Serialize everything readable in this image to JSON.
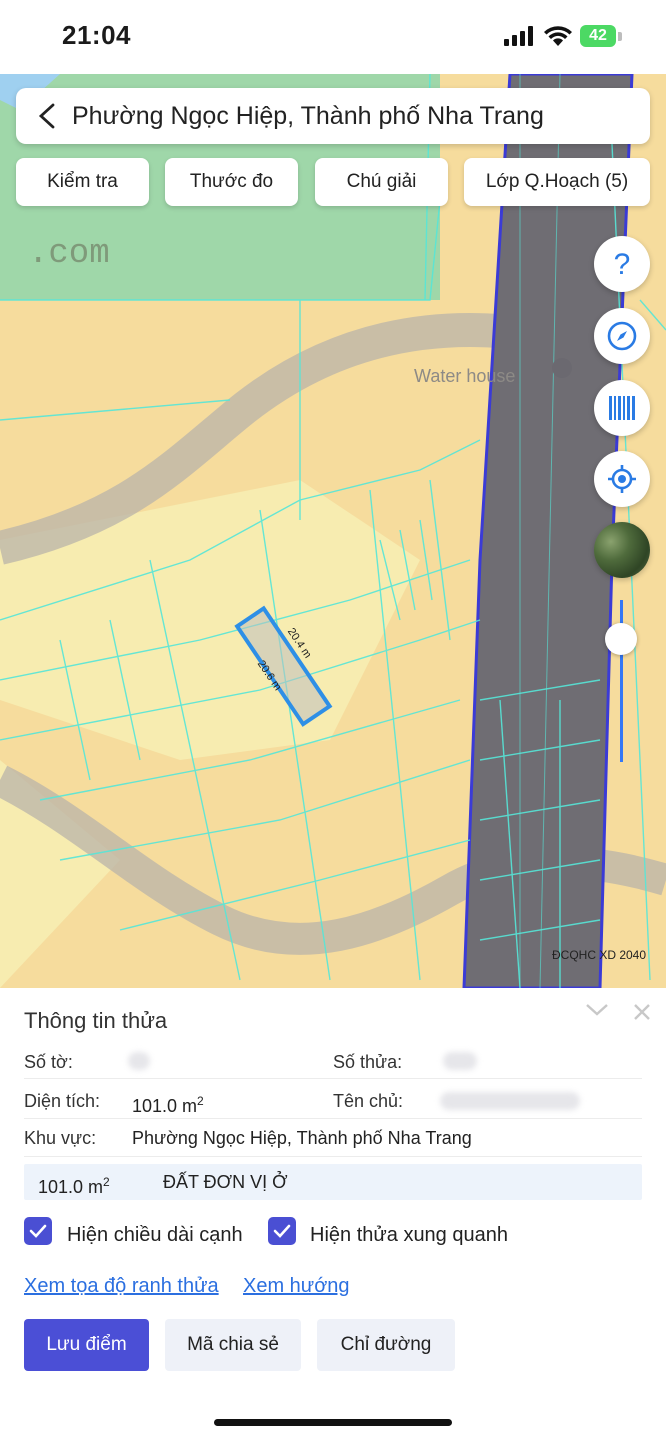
{
  "status": {
    "time": "21:04",
    "battery": "42"
  },
  "header": {
    "title": "Phường Ngọc Hiệp, Thành phố Nha Trang"
  },
  "toolbar": {
    "check": "Kiểm tra",
    "measure": "Thước đo",
    "legend": "Chú giải",
    "planning_layers": "Lớp Q.Hoạch (5)"
  },
  "map": {
    "watermark": ".com",
    "poi": "Water house",
    "edge_a": "20.4 m",
    "edge_b": "20.6 m",
    "source": "ĐCQHC XD 2040",
    "colors": {
      "residential": "#f6dc9d",
      "road": "#6f6d73",
      "parcel_lines": "#56e6d8",
      "boundary": "#3b3bd6",
      "selected": "#2e8fe6"
    }
  },
  "sheet": {
    "title": "Thông tin thửa",
    "sheet_no_label": "Số tờ:",
    "parcel_no_label": "Số thửa:",
    "area_label": "Diện tích:",
    "area_value": "101.0 m",
    "area_unit_sup": "2",
    "owner_label": "Tên chủ:",
    "region_label": "Khu vực:",
    "region_value": "Phường Ngọc Hiệp, Thành phố Nha Trang",
    "land_area": "101.0 m",
    "land_area_sup": "2",
    "land_type": "ĐẤT ĐƠN VỊ Ở",
    "show_edge_length": "Hiện chiều dài cạnh",
    "show_neighbors": "Hiện thửa xung quanh",
    "link_coords": "Xem tọa độ ranh thửa",
    "link_direction": "Xem hướng",
    "btn_save": "Lưu điểm",
    "btn_share": "Mã chia sẻ",
    "btn_route": "Chỉ đường"
  }
}
